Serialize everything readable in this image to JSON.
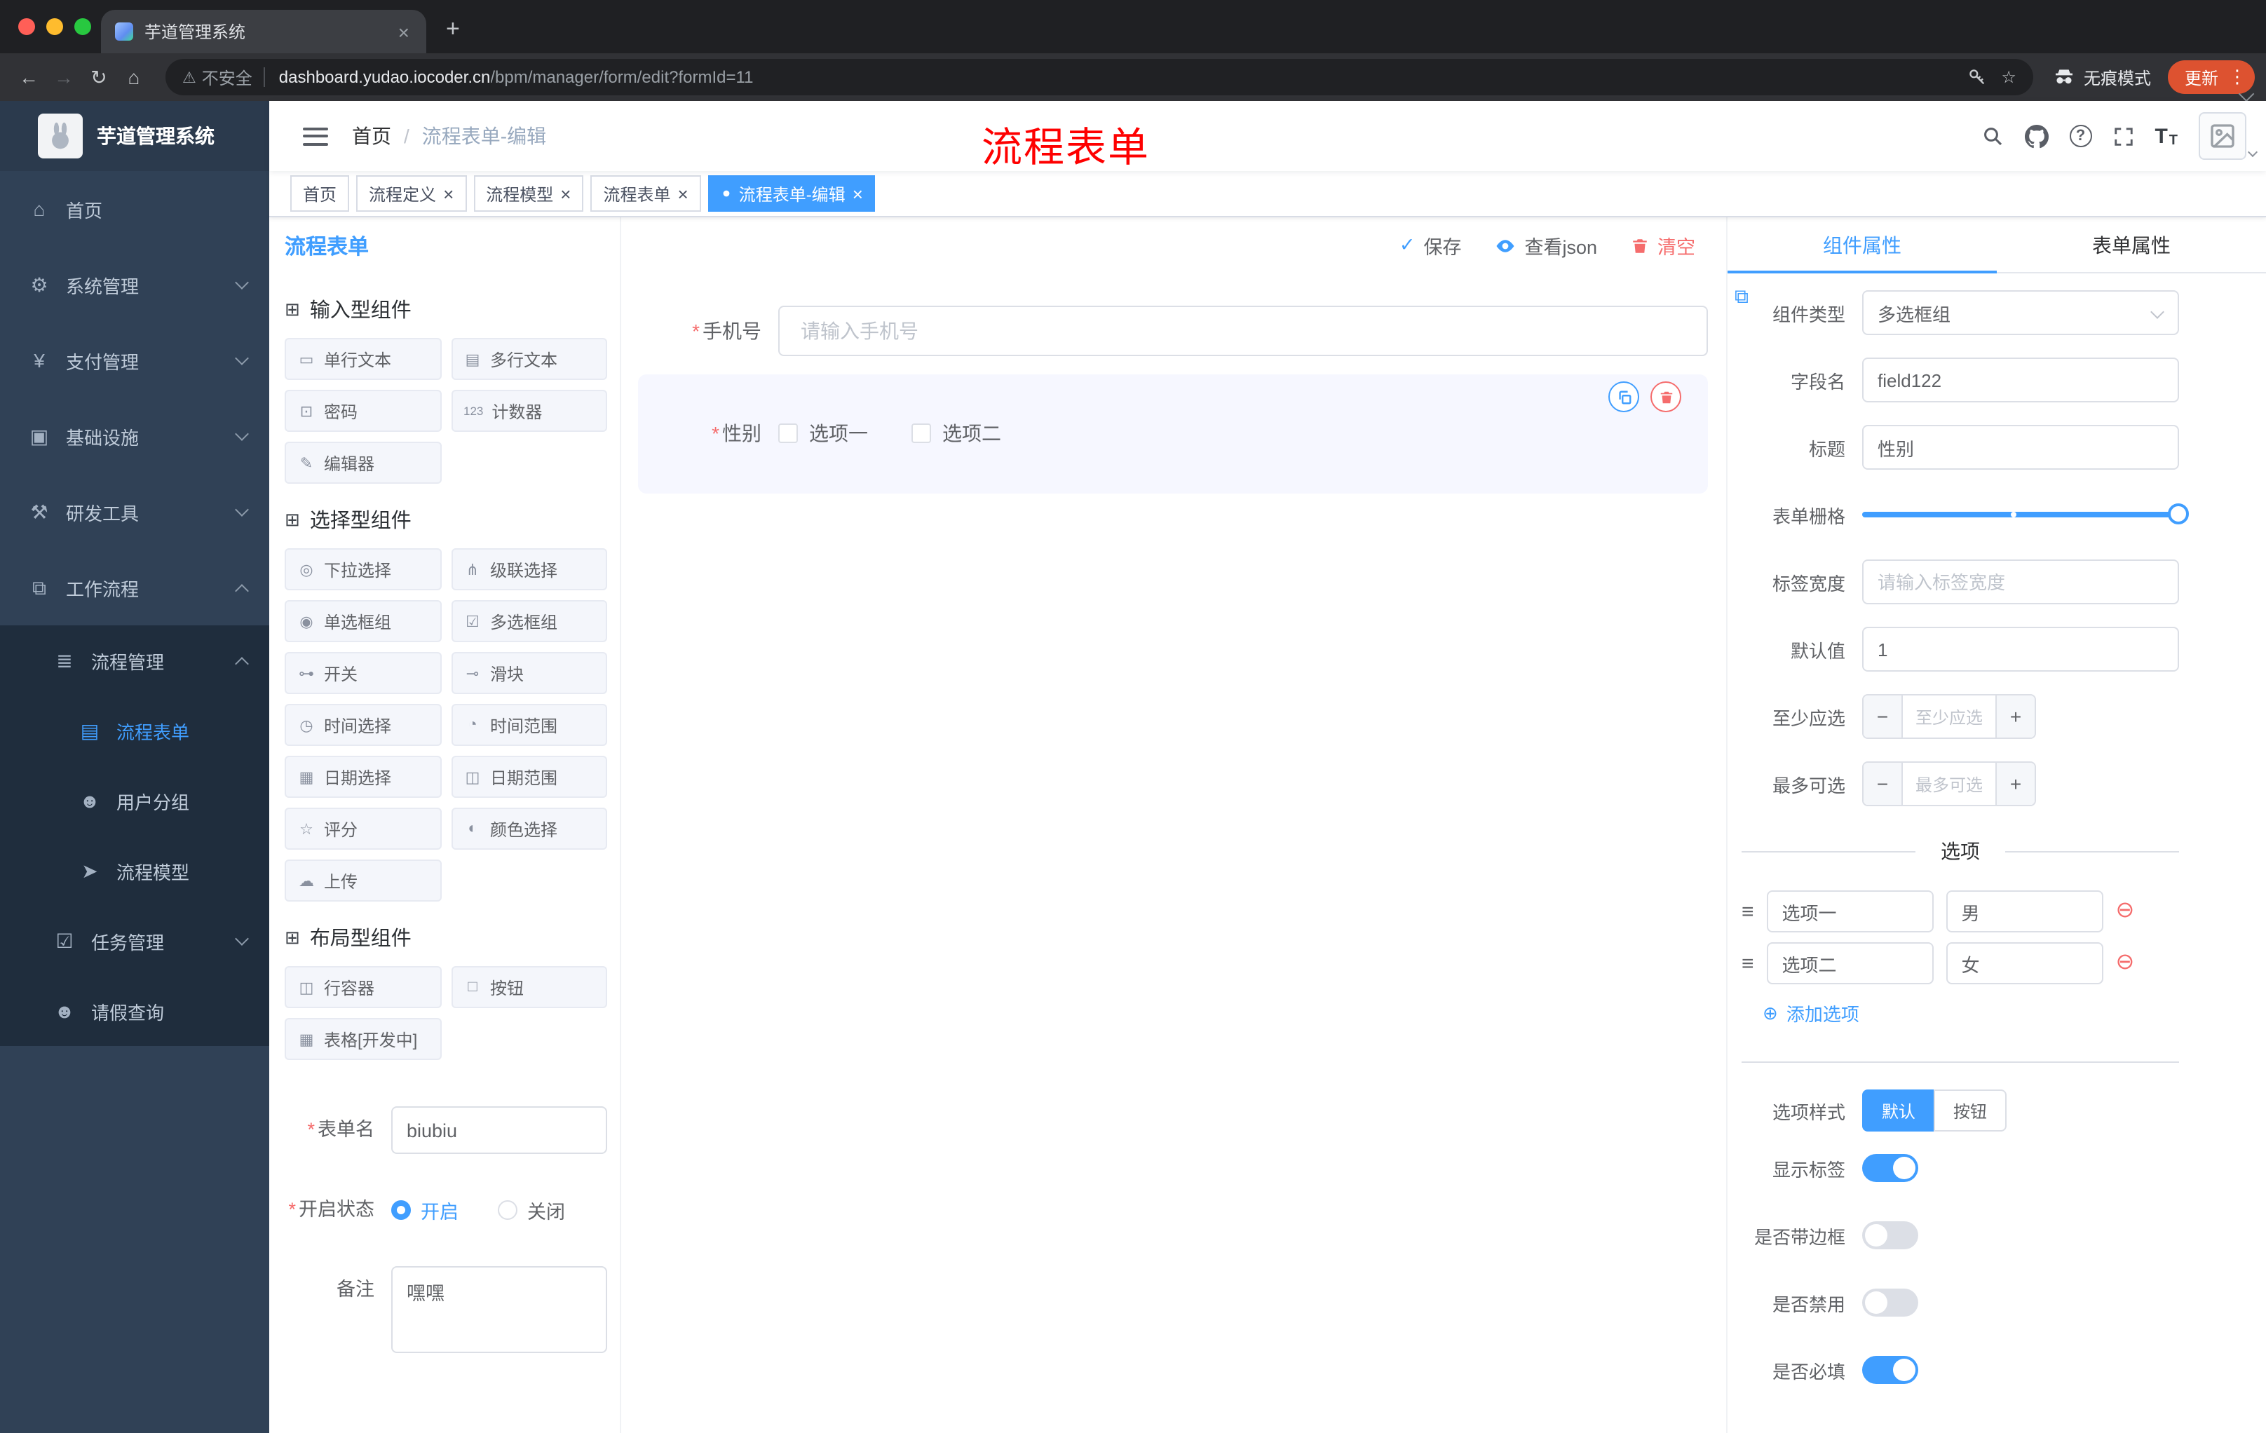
{
  "colors": {
    "accent": "#409eff",
    "danger": "#f56c6c",
    "watermark_red": "#fe0000",
    "sidebar_bg": "#304156",
    "submenu_bg": "#1f2d3d",
    "update_button": "#dd5230"
  },
  "ui": {
    "required_mark": "*"
  },
  "icons": {
    "warning": "⚠",
    "star": "☆",
    "question": "?",
    "font_size": "T",
    "dots": "⋮",
    "plus": "+",
    "minus": "−",
    "close": "×",
    "check": "✓",
    "dot": "●",
    "back": "←",
    "forward": "→",
    "reload": "↻",
    "home": "⌂",
    "group": "⊞",
    "plus_circle": "⊕",
    "minus_circle": "⊖",
    "drag": "≡",
    "link": "⧉"
  },
  "browser": {
    "tab_title": "芋道管理系统",
    "security_label": "不安全",
    "url_host": "dashboard.yudao.iocoder.cn",
    "url_path": "/bpm/manager/form/edit?formId=11",
    "incognito_label": "无痕模式",
    "update_label": "更新"
  },
  "sidebar": {
    "logo": "芋道管理系统",
    "top_items": [
      {
        "label": "首页",
        "icon": "⌂"
      },
      {
        "label": "系统管理",
        "icon": "⚙"
      },
      {
        "label": "支付管理",
        "icon": "¥"
      },
      {
        "label": "基础设施",
        "icon": "▣"
      },
      {
        "label": "研发工具",
        "icon": "⚒"
      },
      {
        "label": "工作流程",
        "icon": "⧉"
      }
    ],
    "process_mgmt": {
      "label": "流程管理",
      "icon": "≣"
    },
    "process_children": [
      {
        "label": "流程表单",
        "icon": "▤"
      },
      {
        "label": "用户分组",
        "icon": "☻"
      },
      {
        "label": "流程模型",
        "icon": "➤"
      }
    ],
    "task_mgmt": {
      "label": "任务管理",
      "icon": "☑"
    },
    "leave_query": {
      "label": "请假查询",
      "icon": "☻"
    }
  },
  "app_header": {
    "breadcrumb_home": "首页",
    "separator": "/",
    "breadcrumb_current": "流程表单-编辑",
    "watermark": "流程表单"
  },
  "tags": {
    "items": [
      "首页",
      "流程定义",
      "流程模型",
      "流程表单",
      "流程表单-编辑"
    ]
  },
  "designer": {
    "title": "流程表单",
    "actions": {
      "save": "保存",
      "view_json": "查看json",
      "clear": "清空"
    },
    "palette": {
      "groups": [
        {
          "title": "输入型组件",
          "items": [
            {
              "label": "单行文本",
              "icon": "▭"
            },
            {
              "label": "多行文本",
              "icon": "▤"
            },
            {
              "label": "密码",
              "icon": "⊡"
            },
            {
              "label": "计数器",
              "icon": "123"
            },
            {
              "label": "编辑器",
              "icon": "✎"
            }
          ]
        },
        {
          "title": "选择型组件",
          "items": [
            {
              "label": "下拉选择",
              "icon": "◎"
            },
            {
              "label": "级联选择",
              "icon": "⋔"
            },
            {
              "label": "单选框组",
              "icon": "◉"
            },
            {
              "label": "多选框组",
              "icon": "☑"
            },
            {
              "label": "开关",
              "icon": "⊶"
            },
            {
              "label": "滑块",
              "icon": "⊸"
            },
            {
              "label": "时间选择",
              "icon": "◷"
            },
            {
              "label": "时间范围",
              "icon": "◔"
            },
            {
              "label": "日期选择",
              "icon": "▦"
            },
            {
              "label": "日期范围",
              "icon": "◫"
            },
            {
              "label": "评分",
              "icon": "☆"
            },
            {
              "label": "颜色选择",
              "icon": "◐"
            },
            {
              "label": "上传",
              "icon": "☁"
            }
          ]
        },
        {
          "title": "布局型组件",
          "items": [
            {
              "label": "行容器",
              "icon": "◫"
            },
            {
              "label": "按钮",
              "icon": "□"
            },
            {
              "label": "表格[开发中]",
              "icon": "▦"
            }
          ]
        }
      ]
    },
    "form_settings": {
      "name_label": "表单名",
      "name_value": "biubiu",
      "status_label": "开启状态",
      "status_on": "开启",
      "status_off": "关闭",
      "remark_label": "备注",
      "remark_value": "嘿嘿"
    },
    "canvas": {
      "phone": {
        "label": "手机号",
        "placeholder": "请输入手机号"
      },
      "gender": {
        "label": "性别",
        "options": [
          "选项一",
          "选项二"
        ]
      }
    },
    "props": {
      "tab_component": "组件属性",
      "tab_form": "表单属性",
      "component_type_label": "组件类型",
      "component_type_value": "多选框组",
      "field_name_label": "字段名",
      "field_name_value": "field122",
      "title_label": "标题",
      "title_value": "性别",
      "grid_label": "表单栅格",
      "label_width_label": "标签宽度",
      "label_width_placeholder": "请输入标签宽度",
      "default_label": "默认值",
      "default_value": "1",
      "min_label": "至少应选",
      "min_placeholder": "至少应选",
      "max_label": "最多可选",
      "max_placeholder": "最多可选",
      "options_title": "选项",
      "options": [
        {
          "label": "选项一",
          "value": "男"
        },
        {
          "label": "选项二",
          "value": "女"
        }
      ],
      "add_option": "添加选项",
      "option_style_label": "选项样式",
      "style_default": "默认",
      "style_button": "按钮",
      "toggles": [
        {
          "label": "显示标签",
          "on": true
        },
        {
          "label": "是否带边框",
          "on": false
        },
        {
          "label": "是否禁用",
          "on": false
        },
        {
          "label": "是否必填",
          "on": true
        }
      ]
    }
  }
}
